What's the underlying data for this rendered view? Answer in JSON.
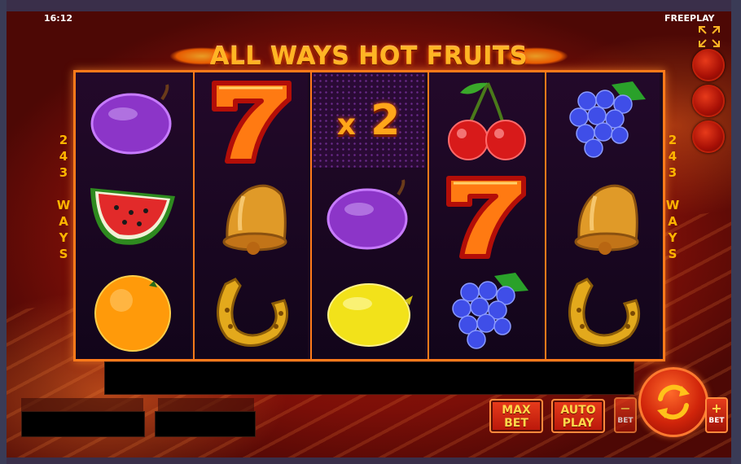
{
  "status": {
    "time": "16:12",
    "mode": "FREEPLAY"
  },
  "title": "ALL WAYS HOT FRUITS",
  "ways_label": {
    "digits": [
      "2",
      "4",
      "3"
    ],
    "word": [
      "W",
      "A",
      "Y",
      "S"
    ]
  },
  "reels": [
    [
      "plum",
      "watermelon",
      "orange"
    ],
    [
      "seven",
      "bell",
      "horseshoe"
    ],
    [
      "multiplier",
      "plum",
      "lemon"
    ],
    [
      "cherry",
      "seven",
      "grapes"
    ],
    [
      "grapes",
      "bell",
      "horseshoe"
    ]
  ],
  "multiplier": {
    "prefix": "x",
    "value": "2"
  },
  "controls": {
    "max_bet": [
      "MAX",
      "BET"
    ],
    "auto_play": [
      "AUTO",
      "PLAY"
    ],
    "bet_minus": {
      "symbol": "−",
      "label": "BET"
    },
    "bet_plus": {
      "symbol": "+",
      "label": "BET"
    },
    "spin_icon": "spin-arrows-icon",
    "expand_icon": "fullscreen-icon"
  },
  "colors": {
    "accent": "#ff7a1a",
    "gold": "#ffb524",
    "button_red": "#d0240a"
  }
}
